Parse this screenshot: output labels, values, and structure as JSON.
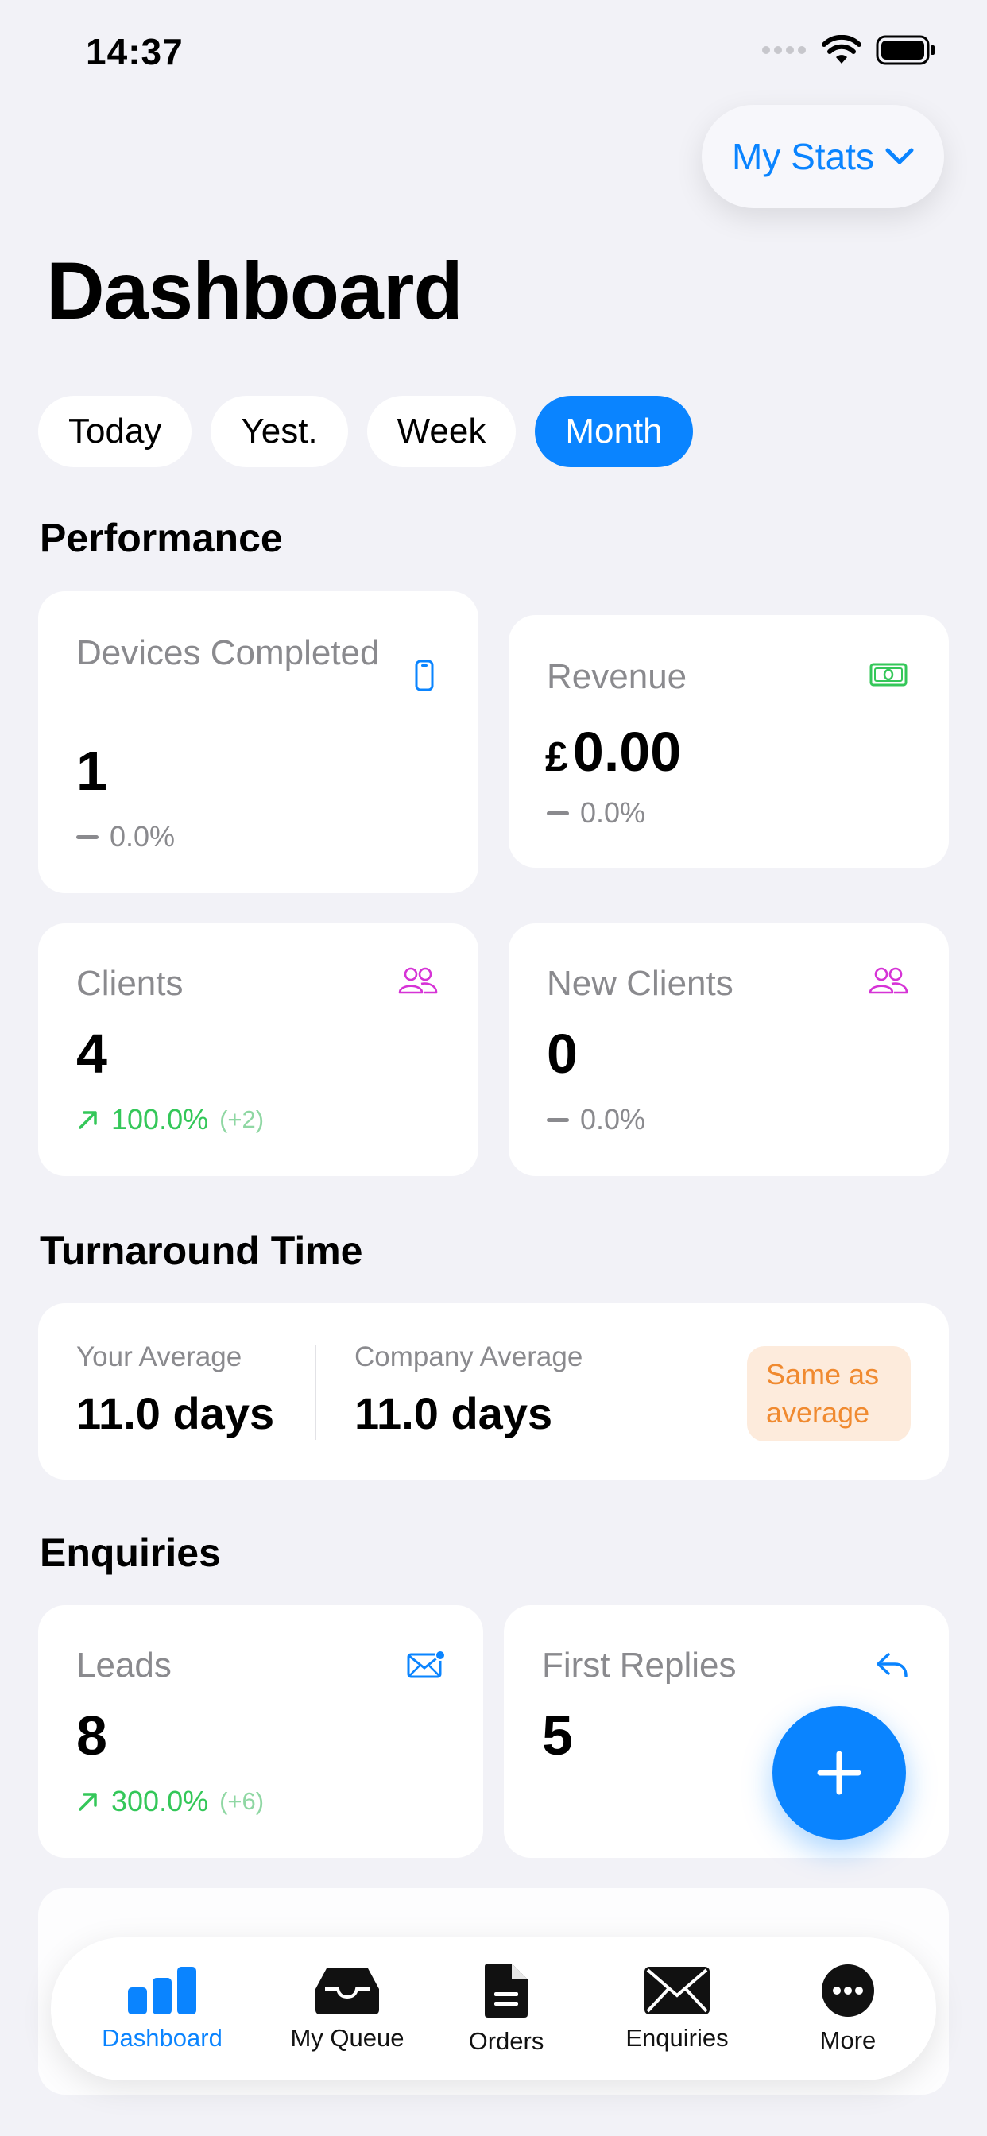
{
  "status_bar": {
    "time": "14:37"
  },
  "header": {
    "stats_selector": "My Stats",
    "title": "Dashboard"
  },
  "periods": [
    {
      "label": "Today",
      "active": false
    },
    {
      "label": "Yest.",
      "active": false
    },
    {
      "label": "Week",
      "active": false
    },
    {
      "label": "Month",
      "active": true
    }
  ],
  "performance": {
    "title": "Performance",
    "devices": {
      "label": "Devices Completed",
      "value": "1",
      "delta": "0.0%",
      "icon": "phone-icon"
    },
    "revenue": {
      "label": "Revenue",
      "currency": "£",
      "value": "0.00",
      "delta": "0.0%",
      "icon": "banknote-icon"
    },
    "clients": {
      "label": "Clients",
      "value": "4",
      "delta": "100.0%",
      "delta_sub": "(+2)",
      "icon": "people-icon"
    },
    "new_clients": {
      "label": "New Clients",
      "value": "0",
      "delta": "0.0%",
      "icon": "people-icon"
    }
  },
  "turnaround": {
    "title": "Turnaround Time",
    "your_label": "Your Average",
    "your_value": "11.0 days",
    "company_label": "Company Average",
    "company_value": "11.0 days",
    "badge": "Same as average"
  },
  "enquiries": {
    "title": "Enquiries",
    "leads": {
      "label": "Leads",
      "value": "8",
      "delta": "300.0%",
      "delta_sub": "(+6)",
      "icon": "envelope-badge-icon"
    },
    "first_replies": {
      "label": "First Replies",
      "value": "5",
      "icon": "reply-icon"
    }
  },
  "tabbar": [
    {
      "label": "Dashboard",
      "icon": "chart-bar-icon",
      "active": true
    },
    {
      "label": "My Queue",
      "icon": "tray-icon",
      "active": false
    },
    {
      "label": "Orders",
      "icon": "document-icon",
      "active": false
    },
    {
      "label": "Enquiries",
      "icon": "envelope-icon",
      "active": false
    },
    {
      "label": "More",
      "icon": "ellipsis-icon",
      "active": false
    }
  ],
  "colors": {
    "accent": "#0a84ff",
    "positive": "#34c759",
    "revenue_icon": "#34c759",
    "people_icon": "#d633d6",
    "badge_text": "#f08a30"
  }
}
